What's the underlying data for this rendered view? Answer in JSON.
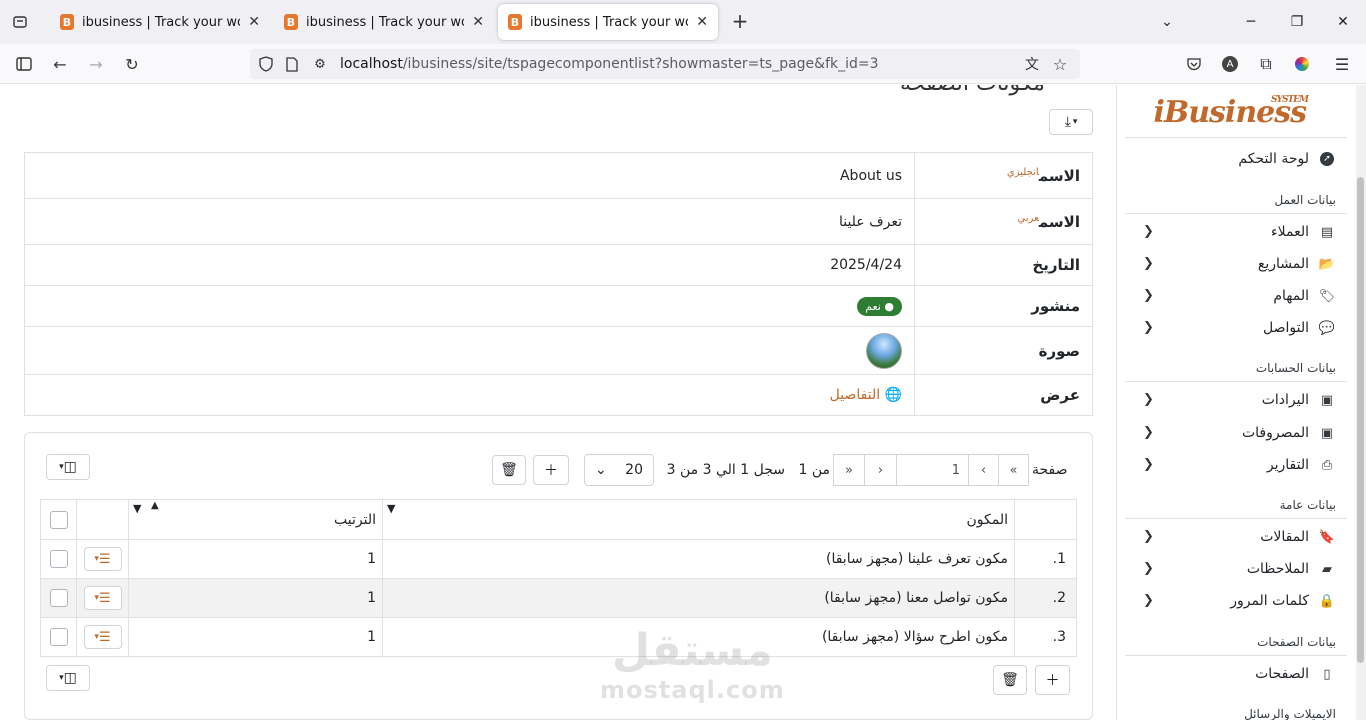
{
  "browser": {
    "tabs": [
      {
        "title": "ibusiness | Track your work with"
      },
      {
        "title": "ibusiness | Track your work with"
      },
      {
        "title": "ibusiness | Track your work with"
      }
    ],
    "url_host": "localhost",
    "url_path": "/ibusiness/site/tspagecomponentlist?showmaster=ts_page&fk_id=3"
  },
  "sidebar": {
    "logo": "iBusiness",
    "logo_small": "SYSTEM",
    "dashboard": "لوحة التحكم",
    "sections": [
      {
        "header": "بيانات العمل",
        "items": [
          "العملاء",
          "المشاريع",
          "المهام",
          "التواصل"
        ]
      },
      {
        "header": "بيانات الحسابات",
        "items": [
          "اليرادات",
          "المصروفات",
          "التقارير"
        ]
      },
      {
        "header": "بيانات عامة",
        "items": [
          "المقالات",
          "الملاحظات",
          "كلمات المرور"
        ]
      },
      {
        "header": "بيانات الصفحات",
        "items": [
          "الصفحات"
        ]
      },
      {
        "header": "الايميلات والرسائل",
        "items": []
      }
    ]
  },
  "page_title": "مكونات الصفحة",
  "details": {
    "name_en_label": "الاسم",
    "name_en_sup": "انجليزي",
    "name_en_value": "About us",
    "name_ar_label": "الاسم",
    "name_ar_sup": "عربي",
    "name_ar_value": "تعرف علينا",
    "date_label": "التاريخ",
    "date_value": "2025/4/24",
    "published_label": "منشور",
    "published_value": "نعم",
    "image_label": "صورة",
    "view_label": "عرض",
    "view_link": "التفاصيل"
  },
  "grid_toolbar": {
    "page_label": "صفحة",
    "page_value": "1",
    "of_label": "من 1",
    "records_label": "سجل 1 الي 3 من 3",
    "page_size": "20"
  },
  "grid": {
    "columns": [
      "المكون",
      "الترتيب"
    ],
    "rows": [
      {
        "num": "1.",
        "component": "مكون تعرف علينا (مجهز سابقا)",
        "order": "1"
      },
      {
        "num": "2.",
        "component": "مكون تواصل معنا (مجهز سابقا)",
        "order": "1"
      },
      {
        "num": "3.",
        "component": "مكون اطرح سؤالا (مجهز سابقا)",
        "order": "1"
      }
    ]
  },
  "watermark": {
    "arabic": "مستقل",
    "latin": "mostaql.com"
  },
  "colors": {
    "accent": "#c0692a",
    "success": "#2e7d32",
    "border": "#dee2e6"
  }
}
